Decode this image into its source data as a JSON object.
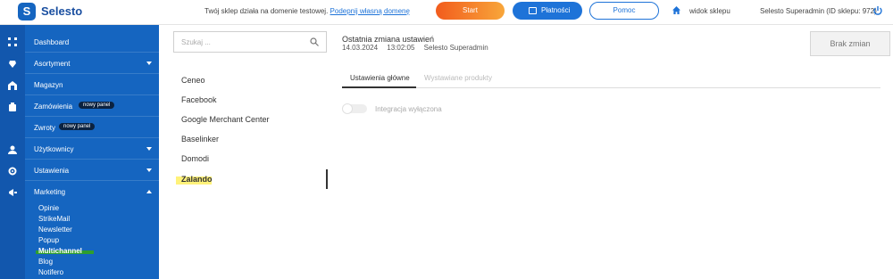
{
  "app": {
    "brand": "Selesto",
    "logo_letter": "S"
  },
  "topbar": {
    "notice_text": "Twój sklep działa na domenie testowej.",
    "notice_link": "Podepnij własną domenę",
    "start_label": "Start",
    "payments_label": "Płatności",
    "help_label": "Pomoc",
    "view_shop_label": "widok sklepu",
    "user_label": "Selesto Superadmin (ID sklepu: 972)"
  },
  "sidebar": {
    "items": [
      {
        "label": "Dashboard"
      },
      {
        "label": "Asortyment"
      },
      {
        "label": "Magazyn"
      },
      {
        "label": "Zamówienia",
        "badge": "nowy panel"
      },
      {
        "label": "Zwroty",
        "badge": "nowy panel"
      },
      {
        "label": "Użytkownicy"
      },
      {
        "label": "Ustawienia"
      },
      {
        "label": "Marketing"
      }
    ],
    "marketing_sub": [
      "Opinie",
      "StrikeMail",
      "Newsletter",
      "Popup",
      "Multichannel",
      "Blog",
      "Notifero"
    ]
  },
  "channels": {
    "search_placeholder": "Szukaj ...",
    "items": [
      "Ceneo",
      "Facebook",
      "Google Merchant Center",
      "Baselinker",
      "Domodi",
      "Zalando"
    ]
  },
  "main": {
    "last_change_title": "Ostatnia zmiana ustawień",
    "last_change_date": "14.03.2024",
    "last_change_time": "13:02:05",
    "last_change_user": "Selesto Superadmin",
    "no_changes_label": "Brak zmian",
    "tabs": [
      {
        "label": "Ustawienia główne"
      },
      {
        "label": "Wystawiane produkty"
      }
    ],
    "integration_label": "Integracja wyłączona",
    "integration_enabled": false
  },
  "colors": {
    "sidebar": "#1565c0",
    "accent": "#1e73d8",
    "start_gradient": "#f25c1d",
    "highlight_green": "#2e9e2e",
    "highlight_yellow": "#fff27a"
  }
}
